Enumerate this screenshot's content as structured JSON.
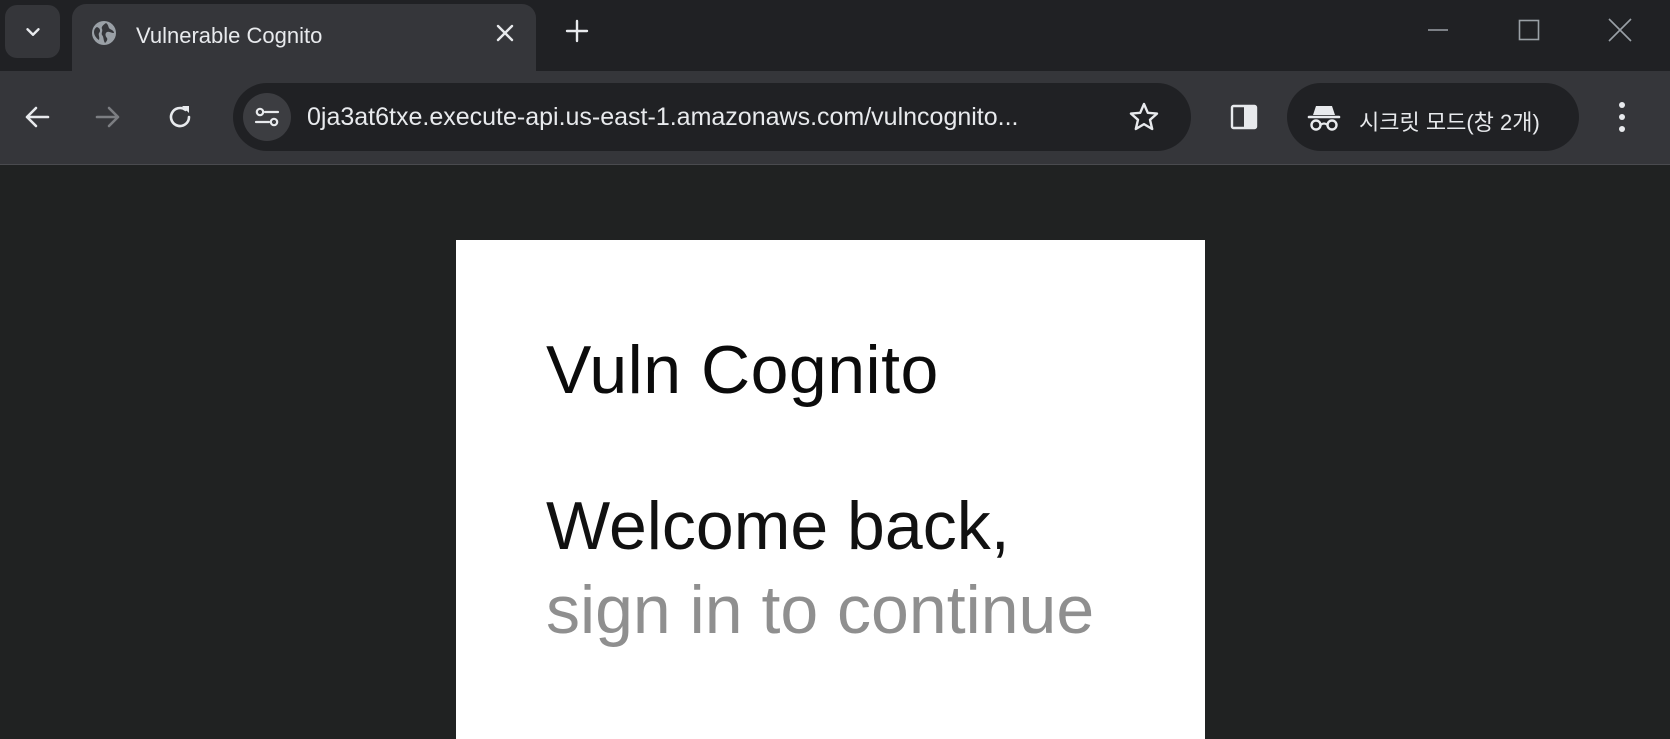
{
  "browser": {
    "tab": {
      "title": "Vulnerable Cognito",
      "favicon": "globe-icon",
      "close_icon": "close-icon"
    },
    "new_tab_icon": "plus-icon",
    "window_controls": [
      "minimize-icon",
      "maximize-icon",
      "close-window-icon"
    ],
    "toolbar": {
      "back_icon": "back-arrow-icon",
      "forward_icon": "forward-arrow-icon",
      "reload_icon": "reload-icon",
      "url": "0ja3at6txe.execute-api.us-east-1.amazonaws.com/vulncognito...",
      "site_info_icon": "tune-icon",
      "bookmark_icon": "star-icon",
      "side_panel_icon": "side-panel-icon",
      "incognito": {
        "icon": "incognito-icon",
        "label": "시크릿 모드(창 2개)"
      },
      "menu_icon": "kebab-menu-icon"
    },
    "colors": {
      "frame": "#202124",
      "toolbar": "#35363a",
      "text": "#e8eaed",
      "page_bg": "#202222",
      "card_bg": "#ffffff",
      "subtitle": "#8f8f8f"
    }
  },
  "page": {
    "app_title": "Vuln Cognito",
    "welcome": "Welcome back,",
    "subtitle": "sign in to continue"
  }
}
